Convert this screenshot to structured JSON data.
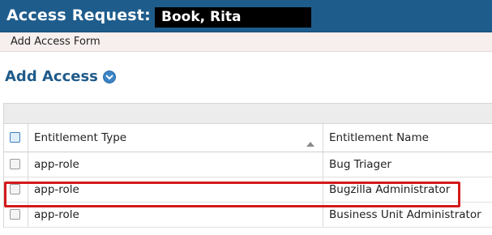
{
  "titlebar": {
    "title": "Access Request:",
    "user_name": "Book, Rita"
  },
  "subbar": {
    "label": "Add Access Form"
  },
  "add_access": {
    "heading": "Add Access",
    "dropdown_icon": "chevron-down-icon"
  },
  "table": {
    "columns": {
      "entitlement_type": "Entitlement Type",
      "entitlement_name": "Entitlement Name"
    },
    "sort_icon": "sort-up-icon",
    "rows": [
      {
        "type": "app-role",
        "name": "Bug Triager"
      },
      {
        "type": "app-role",
        "name": "Bugzilla Administrator"
      },
      {
        "type": "app-role",
        "name": "Business Unit Administrator"
      }
    ]
  },
  "colors": {
    "titlebar_bg": "#1e5c8c",
    "heading_text": "#1f5b8a",
    "highlight_border": "#d31a1a",
    "subbar_bg": "#f7eeee"
  }
}
